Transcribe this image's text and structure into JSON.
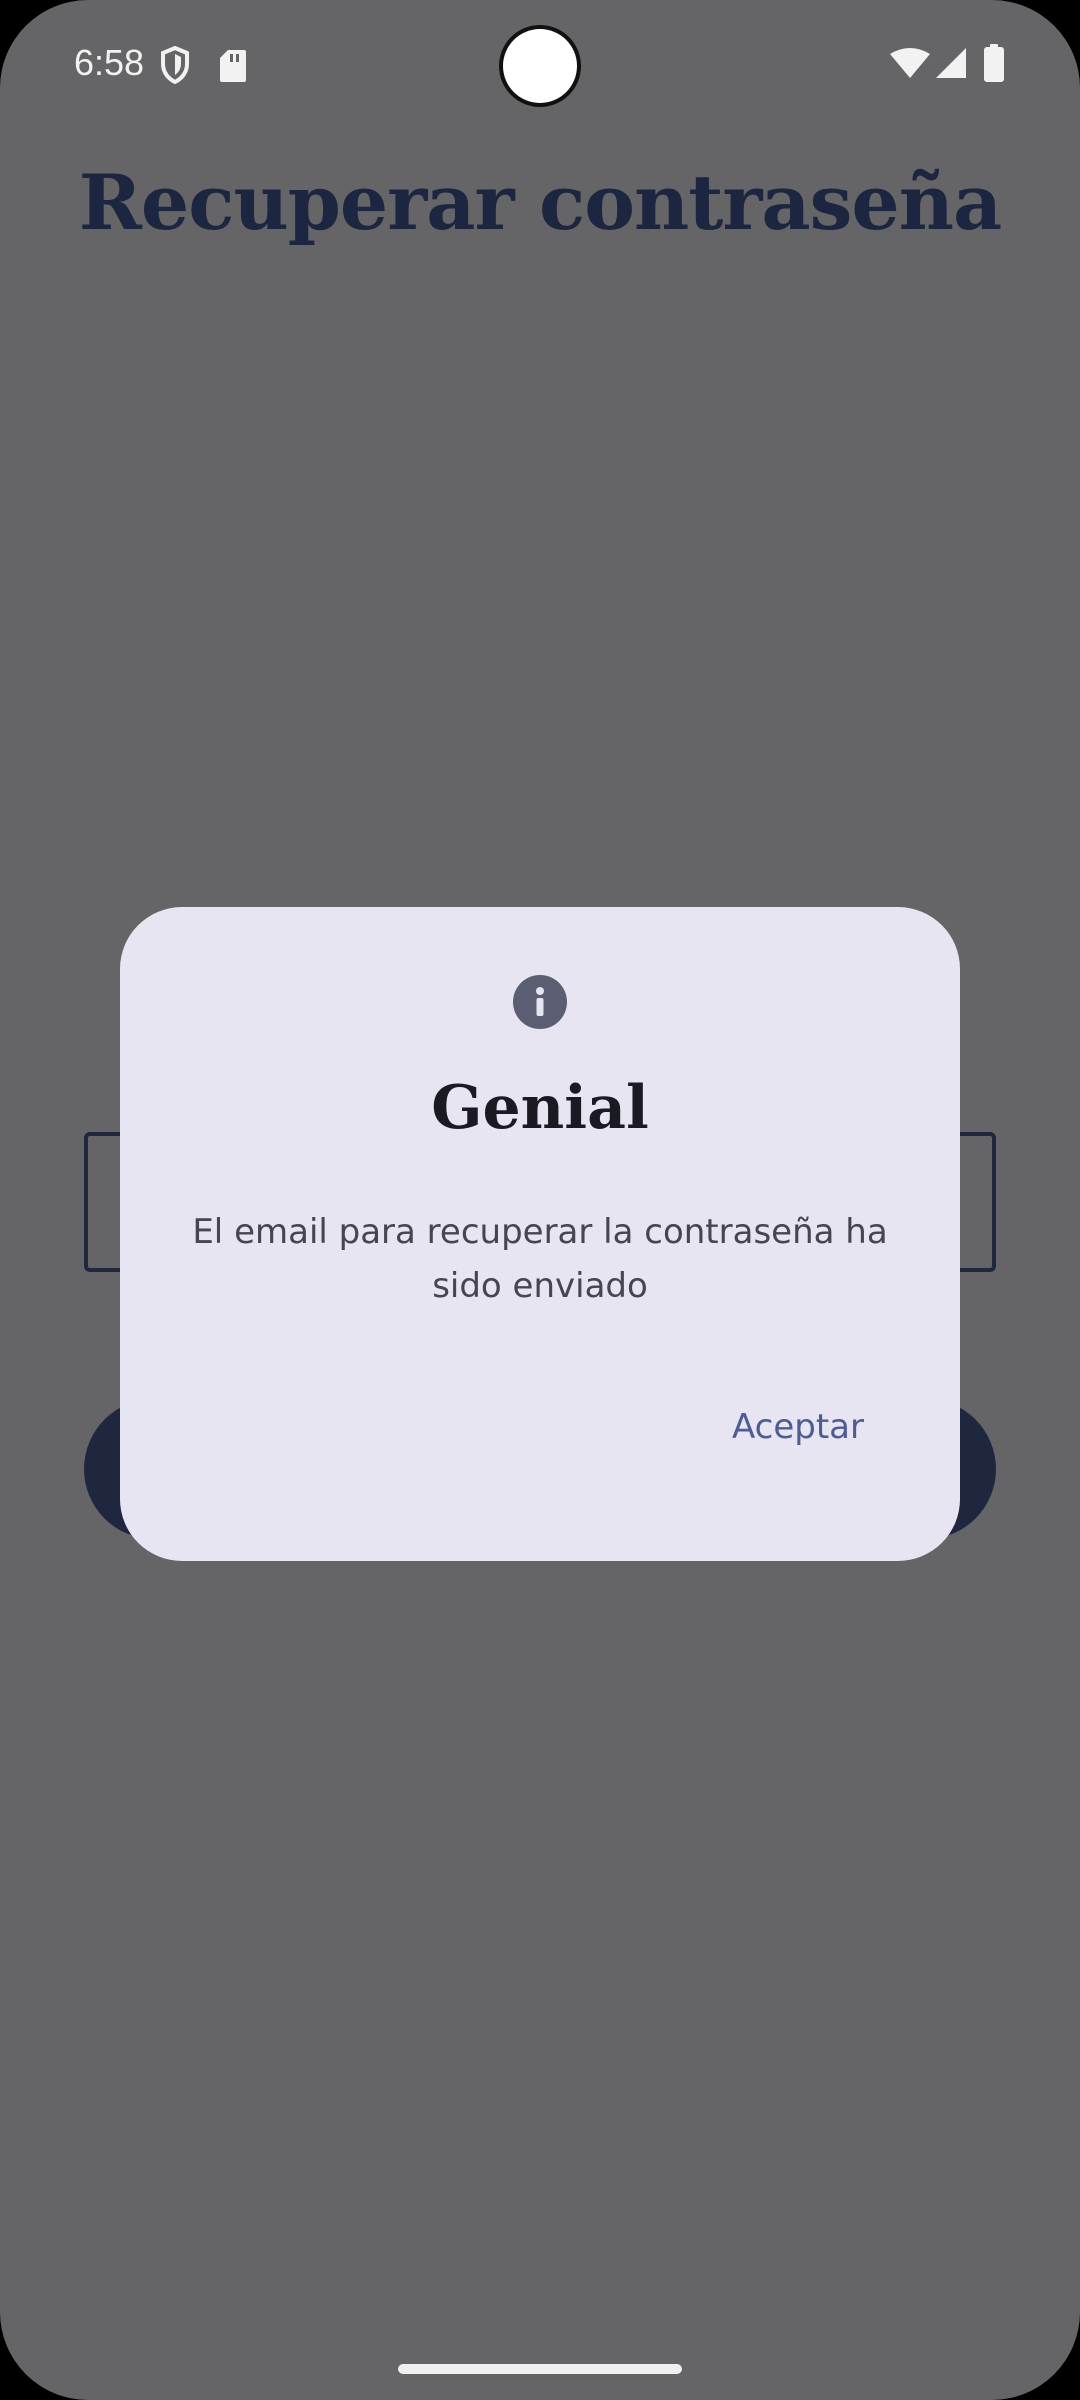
{
  "status_bar": {
    "time": "6:58",
    "left_icons": [
      "shield-icon",
      "sd-card-icon"
    ],
    "right_icons": [
      "wifi-icon",
      "signal-icon",
      "battery-icon"
    ]
  },
  "page": {
    "title": "Recuperar contraseña"
  },
  "dialog": {
    "icon": "info-icon",
    "title": "Genial",
    "message": "El email para recuperar la contraseña ha sido enviado",
    "action_label": "Aceptar"
  },
  "colors": {
    "scrim": "#656567",
    "dialog_bg": "#e6e5f1",
    "title_color": "#1d2640",
    "accent": "#4d5c92"
  }
}
